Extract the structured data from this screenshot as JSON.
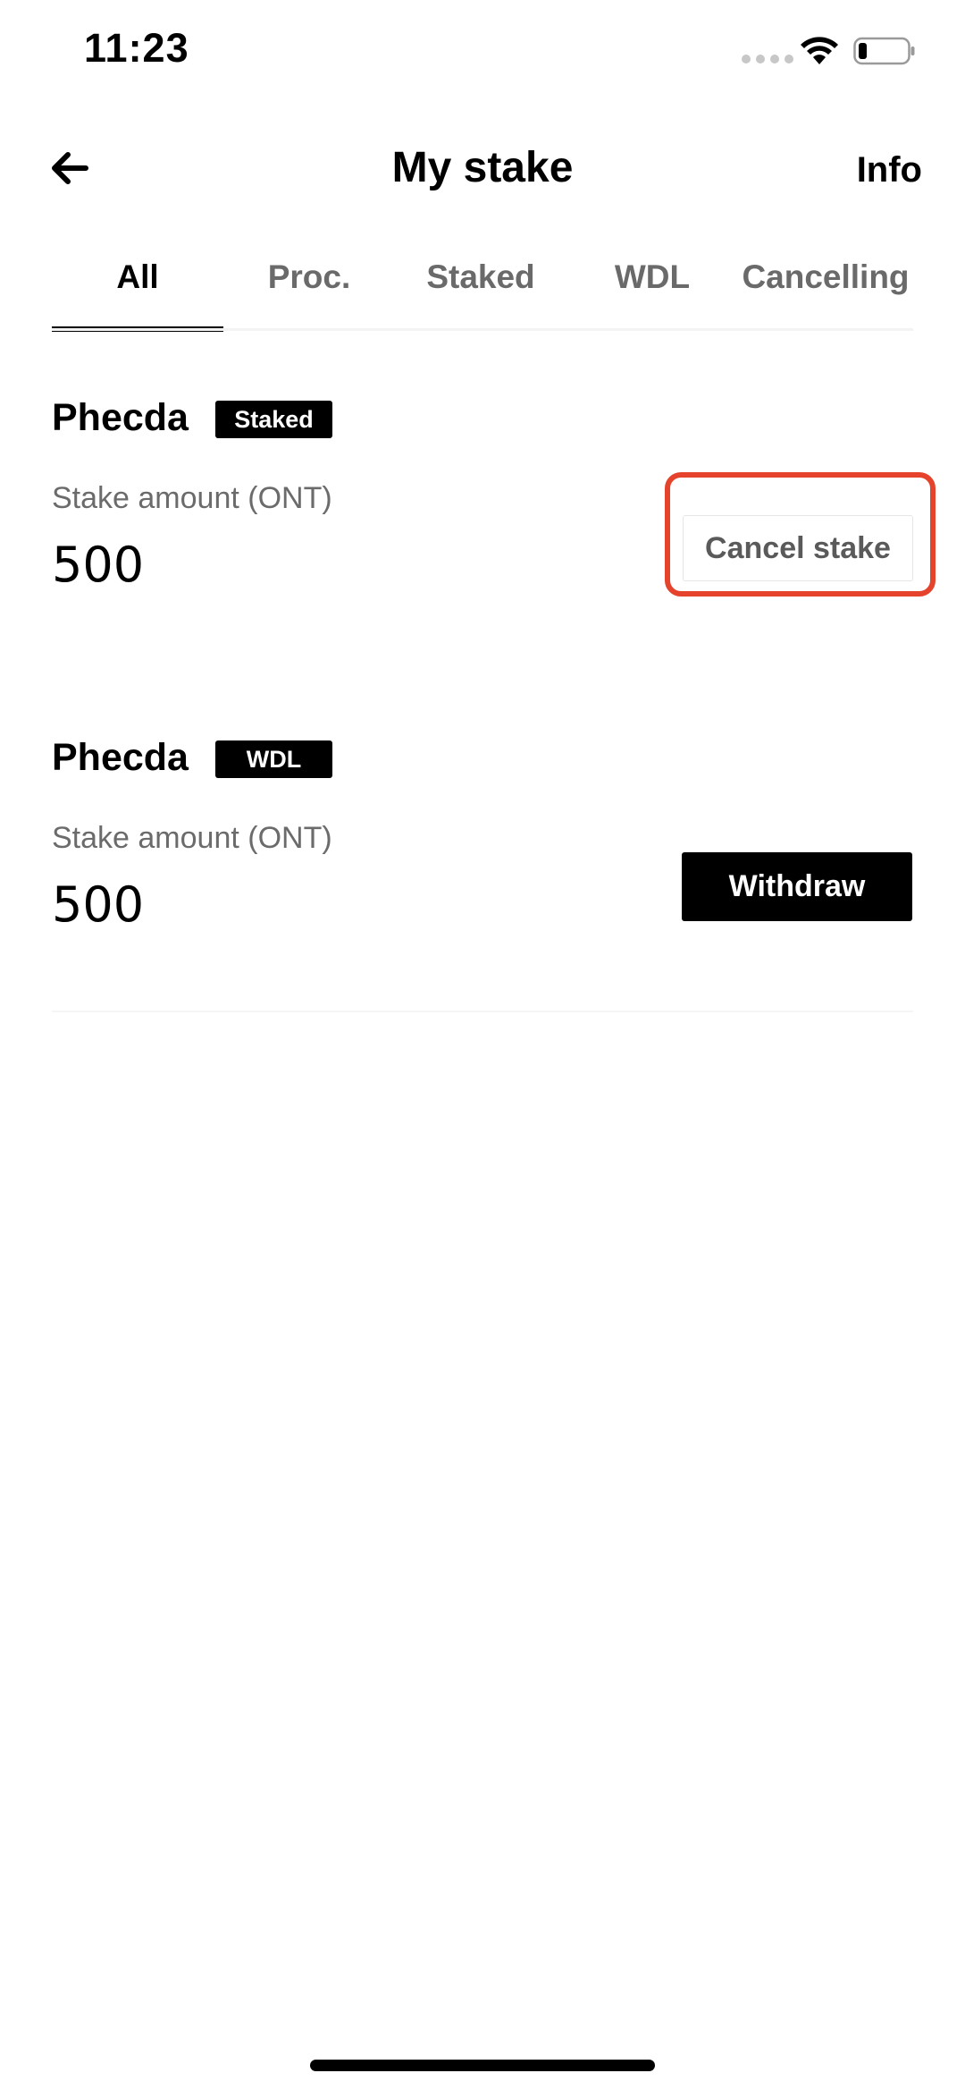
{
  "status_bar": {
    "time": "11:23"
  },
  "header": {
    "title": "My stake",
    "info_label": "Info"
  },
  "tabs": [
    {
      "label": "All",
      "active": true
    },
    {
      "label": "Proc.",
      "active": false
    },
    {
      "label": "Staked",
      "active": false
    },
    {
      "label": "WDL",
      "active": false
    },
    {
      "label": "Cancelling",
      "active": false
    }
  ],
  "stakes": [
    {
      "node": "Phecda",
      "status": "Staked",
      "amount_label": "Stake amount (ONT)",
      "amount": "500",
      "action_label": "Cancel stake"
    },
    {
      "node": "Phecda",
      "status": "WDL",
      "amount_label": "Stake amount (ONT)",
      "amount": "500",
      "action_label": "Withdraw"
    }
  ],
  "colors": {
    "highlight": "#e5432c",
    "accent": "#000000",
    "inactive_tab": "#6a6a6a"
  }
}
